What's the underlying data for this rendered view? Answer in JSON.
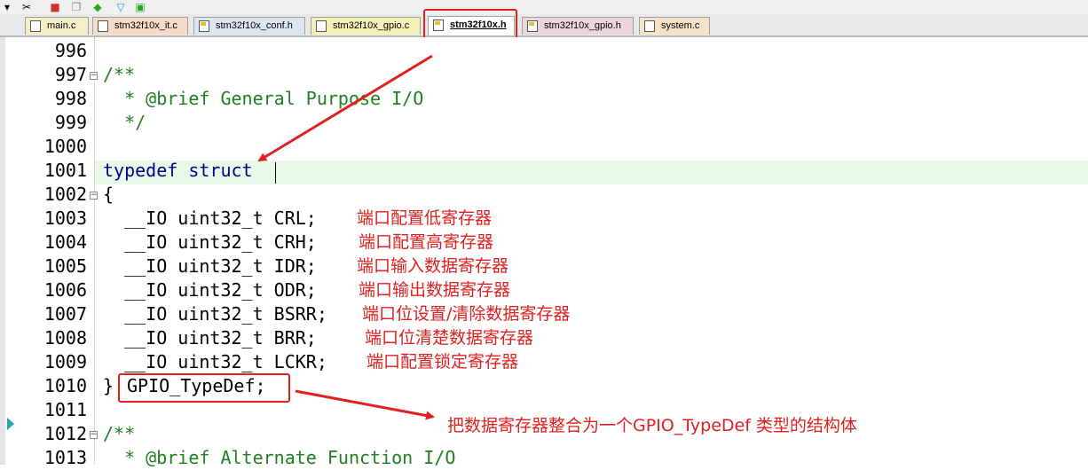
{
  "colors": {
    "keyword": "#00008b",
    "comment": "#208020",
    "annotation": "#e02020",
    "current_line": "#e8f9e8"
  },
  "toolbar": {
    "icons": [
      "dropdown-icon",
      "tools-icon",
      "build-icon",
      "copy-icon",
      "target-icon",
      "filter-icon",
      "manage-icon"
    ]
  },
  "tabs": [
    {
      "label": "main.c",
      "icon": "c-file-icon"
    },
    {
      "label": "stm32f10x_it.c",
      "icon": "c-file-icon"
    },
    {
      "label": "stm32f10x_conf.h",
      "icon": "h-file-icon"
    },
    {
      "label": "stm32f10x_gpio.c",
      "icon": "c-file-icon"
    },
    {
      "label": "stm32f10x.h",
      "icon": "h-file-icon",
      "active": true
    },
    {
      "label": "stm32f10x_gpio.h",
      "icon": "h-file-icon"
    },
    {
      "label": "system.c",
      "icon": "c-file-icon"
    }
  ],
  "editor": {
    "line_numbers": [
      "996",
      "997",
      "998",
      "999",
      "1000",
      "1001",
      "1002",
      "1003",
      "1004",
      "1005",
      "1006",
      "1007",
      "1008",
      "1009",
      "1010",
      "1011",
      "1012",
      "1013"
    ],
    "code": {
      "l997": "/**",
      "l998": "  * @brief General Purpose I/O",
      "l999": "  */",
      "l1001_kw": "typedef struct",
      "l1002": "{",
      "l1003": "  __IO uint32_t CRL;",
      "l1004": "  __IO uint32_t CRH;",
      "l1005": "  __IO uint32_t IDR;",
      "l1006": "  __IO uint32_t ODR;",
      "l1007": "  __IO uint32_t BSRR;",
      "l1008": "  __IO uint32_t BRR;",
      "l1009": "  __IO uint32_t LCKR;",
      "l1010_brace": "}",
      "l1010_name": "GPIO_TypeDef;",
      "l1012": "/**",
      "l1013": "  * @brief Alternate Function I/O"
    },
    "annotations": {
      "crl": "端口配置低寄存器",
      "crh": "端口配置高寄存器",
      "idr": "端口输入数据寄存器",
      "odr": "端口输出数据寄存器",
      "bsrr": "端口位设置/清除数据寄存器",
      "brr": "端口位清楚数据寄存器",
      "lckr": "端口配置锁定寄存器",
      "summary": "把数据寄存器整合为一个GPIO_TypeDef 类型的结构体"
    }
  }
}
